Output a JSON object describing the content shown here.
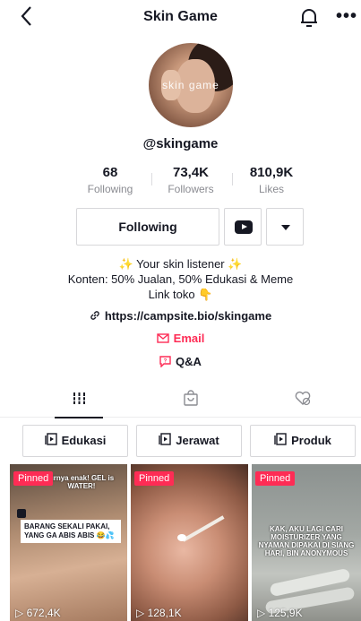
{
  "header": {
    "back_glyph": "<",
    "title": "Skin Game",
    "bell_icon": "bell-icon",
    "more_glyph": "•••"
  },
  "profile": {
    "avatar_text": "skin game",
    "handle": "@skingame",
    "stats": [
      {
        "value": "68",
        "label": "Following"
      },
      {
        "value": "73,4K",
        "label": "Followers"
      },
      {
        "value": "810,9K",
        "label": "Likes"
      }
    ],
    "follow_button": "Following",
    "youtube_icon": "youtube-icon",
    "dropdown_icon": "dropdown-icon"
  },
  "bio": {
    "line1": "✨ Your skin listener ✨",
    "line2": "Konten: 50% Jualan, 50% Edukasi & Meme",
    "line3": "Link toko 👇",
    "link": "https://campsite.bio/skingame",
    "email": "Email",
    "qa": "Q&A"
  },
  "tabs": [
    {
      "icon": "grid-icon",
      "active": true
    },
    {
      "icon": "shop-bag-icon",
      "active": false
    },
    {
      "icon": "heart-hidden-icon",
      "active": false
    }
  ],
  "playlists": [
    {
      "label": "Edukasi"
    },
    {
      "label": "Jerawat"
    },
    {
      "label": "Produk"
    }
  ],
  "videos": [
    {
      "pinned": "Pinned",
      "views": "672,4K",
      "top_overlay": "urnya enak! GEL is WATER!",
      "caption": "BARANG SEKALI PAKAI, YANG GA ABIS ABIS 😂💦"
    },
    {
      "pinned": "Pinned",
      "views": "128,1K"
    },
    {
      "pinned": "Pinned",
      "views": "125,9K",
      "overlay": "KAK, AKU LAGI CARI MOISTURIZER YANG NYAMAN DIPAKAI DI SIANG HARI, BIN ANONYMOUS"
    }
  ],
  "colors": {
    "accent": "#fe2c55",
    "text": "#161823",
    "muted": "#8a8b91"
  }
}
